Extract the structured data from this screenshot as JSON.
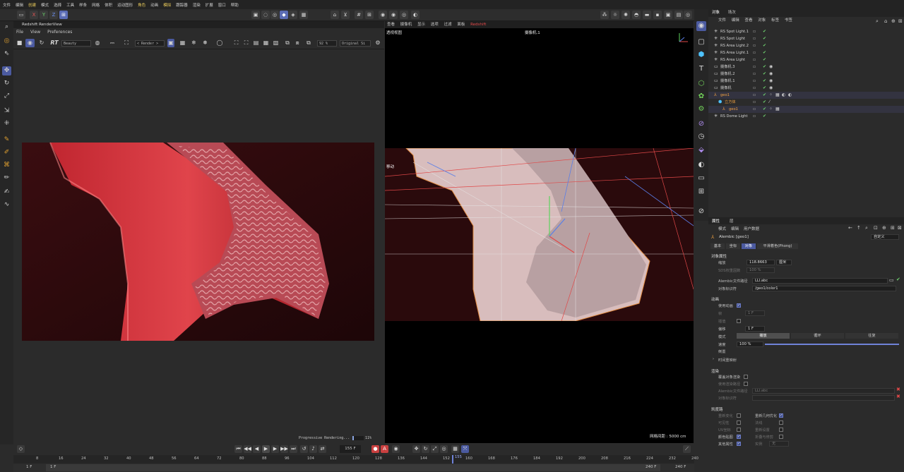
{
  "menubar": [
    "文件",
    "编辑",
    "创建",
    "模式",
    "选择",
    "工具",
    "样条",
    "网格",
    "体积",
    "运动图形",
    "角色",
    "动画",
    "模拟",
    "跟踪器",
    "渲染",
    "扩展",
    "窗口",
    "帮助"
  ],
  "menubar_highlight": [
    2,
    10,
    12
  ],
  "render_view": {
    "title": "Redshift RenderView",
    "menu": [
      "File",
      "View",
      "Preferences"
    ],
    "aov": "Beauty",
    "render_mode": "< Render >",
    "zoom": "92 %",
    "size": "Original Si",
    "rt_label": "RT",
    "status_text": "Progressive Rendering...",
    "progress_pct": "11%",
    "progress": 0.11
  },
  "viewport": {
    "menu": [
      "查看",
      "摄像机",
      "显示",
      "选项",
      "过滤",
      "面板",
      "Redshift"
    ],
    "label": "透视视图",
    "camera": "摄像机.1",
    "move_label": "移动",
    "grid_text": "网格间距 : 5000 cm"
  },
  "object_manager": {
    "tabs": [
      "对象",
      "场次"
    ],
    "menu": [
      "文件",
      "编辑",
      "查看",
      "对象",
      "标签",
      "书签"
    ],
    "rows": [
      {
        "name": "RS Spot Light.1",
        "indent": 0,
        "type": "light"
      },
      {
        "name": "RS Spot Light",
        "indent": 0,
        "type": "light"
      },
      {
        "name": "RS Area Light.2",
        "indent": 0,
        "type": "light"
      },
      {
        "name": "RS Area Light.1",
        "indent": 0,
        "type": "light"
      },
      {
        "name": "RS Area Light",
        "indent": 0,
        "type": "light"
      },
      {
        "name": "摄像机.3",
        "indent": 0,
        "type": "camera"
      },
      {
        "name": "摄像机.2",
        "indent": 0,
        "type": "camera"
      },
      {
        "name": "摄像机.1",
        "indent": 0,
        "type": "camera"
      },
      {
        "name": "摄像机",
        "indent": 0,
        "type": "camera"
      },
      {
        "name": "geo1",
        "indent": 0,
        "type": "geo",
        "orange": true
      },
      {
        "name": "立方体",
        "indent": 1,
        "type": "cube",
        "orange": true
      },
      {
        "name": "geo1",
        "indent": 2,
        "type": "geo",
        "orange": true
      },
      {
        "name": "RS Dome Light",
        "indent": 0,
        "type": "light"
      }
    ]
  },
  "attributes": {
    "tabs": [
      "属性",
      "层"
    ],
    "menu": [
      "模式",
      "编辑",
      "用户数据"
    ],
    "object_name": "Alembic [geo1]",
    "preset": "自定义",
    "sub_tabs": [
      "基本",
      "坐标",
      "对象",
      "平滑着色(Phong)"
    ],
    "section_object": "对象属性",
    "scale_label": "缩放",
    "scale_value": "118.8663",
    "scale_unit": "厘米",
    "sds_label": "SDS权重因数",
    "sds_value": "100 %",
    "alembic_path_label": "Alembic文件路径",
    "alembic_path_value": "LLl.abc",
    "object_id_label": "对象标识符",
    "object_id_value": "/geo1/color1",
    "section_anim": "动画",
    "use_anim_label": "使用动画",
    "frame_label": "帧",
    "frame_value": "1 F",
    "interp_label": "插值",
    "offset_label": "偏移",
    "offset_value": "1 F",
    "mode_label": "模式",
    "mode_options": [
      "播放",
      "循环",
      "往复"
    ],
    "speed_label": "速度",
    "speed_value": "100 %",
    "speed": 1.0,
    "reverse_label": "倒置",
    "time_remap_label": "时间重映射",
    "section_render": "渲染",
    "override_label": "覆盖对象渲染",
    "use_default_label": "使用渲染路径",
    "r_alembic_label": "Alembic文件路径",
    "r_alembic_value": "LLl.abc",
    "r_object_id_label": "对象标识符",
    "section_gen": "凯度路",
    "gen_left": [
      "重新变化",
      "可见性",
      "UV坐标",
      "颜色贴图",
      "其他属性"
    ],
    "gen_right": [
      "重新几何优化",
      "法线",
      "重新设置",
      "折叠与修剪",
      "实例"
    ],
    "instance_value": "无"
  },
  "timeline": {
    "current_frame": "155 F",
    "ticks": [
      "8",
      "16",
      "24",
      "32",
      "40",
      "48",
      "56",
      "64",
      "72",
      "80",
      "88",
      "96",
      "104",
      "112",
      "120",
      "128",
      "136",
      "144",
      "152",
      "160",
      "168",
      "176",
      "184",
      "192",
      "200",
      "208",
      "216",
      "224",
      "232",
      "240"
    ],
    "playhead_label": "155",
    "start_left": "1 F",
    "start_right": "1 F",
    "end_left": "240 F",
    "end_right": "240 F"
  }
}
